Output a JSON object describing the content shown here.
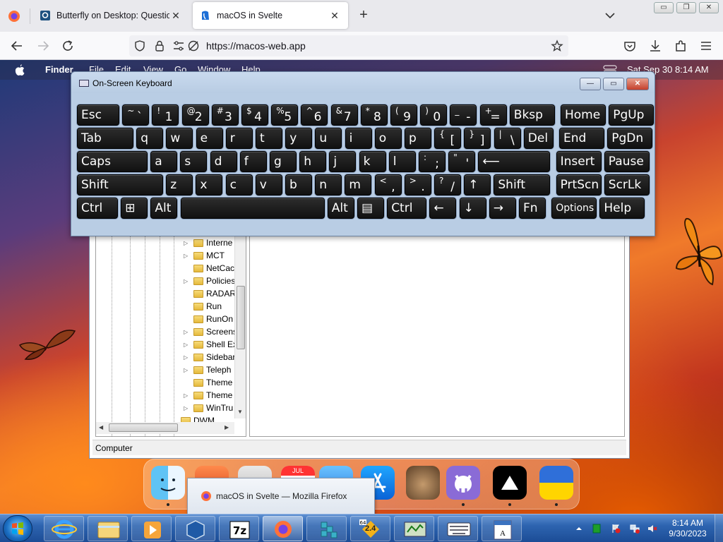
{
  "browser": {
    "tabs": [
      {
        "title": "Butterfly on Desktop: Questions",
        "active": false
      },
      {
        "title": "macOS in Svelte",
        "active": true
      }
    ],
    "url": "https://macos-web.app",
    "window_controls": {
      "minimize": "▭",
      "restore": "❐",
      "close": "✕"
    }
  },
  "menubar": {
    "app": "Finder",
    "items": [
      "File",
      "Edit",
      "View",
      "Go",
      "Window",
      "Help"
    ],
    "clock": "Sat Sep 30   8:14 AM"
  },
  "osk": {
    "title": "On-Screen Keyboard",
    "controls": {
      "minimize": "—",
      "restore": "▭",
      "close": "✕"
    },
    "rows": [
      [
        {
          "label": "Esc"
        },
        {
          "shift": "~",
          "main": "`"
        },
        {
          "shift": "!",
          "main": "1"
        },
        {
          "shift": "@",
          "main": "2"
        },
        {
          "shift": "#",
          "main": "3"
        },
        {
          "shift": "$",
          "main": "4"
        },
        {
          "shift": "%",
          "main": "5"
        },
        {
          "shift": "^",
          "main": "6"
        },
        {
          "shift": "&",
          "main": "7"
        },
        {
          "shift": "*",
          "main": "8"
        },
        {
          "shift": "(",
          "main": "9"
        },
        {
          "shift": ")",
          "main": "0"
        },
        {
          "shift": "_",
          "main": "-"
        },
        {
          "shift": "+",
          "main": "="
        },
        {
          "label": "Bksp"
        },
        {
          "label": "Home"
        },
        {
          "label": "PgUp"
        }
      ],
      [
        {
          "label": "Tab"
        },
        {
          "label": "q"
        },
        {
          "label": "w"
        },
        {
          "label": "e"
        },
        {
          "label": "r"
        },
        {
          "label": "t"
        },
        {
          "label": "y"
        },
        {
          "label": "u"
        },
        {
          "label": "i"
        },
        {
          "label": "o"
        },
        {
          "label": "p"
        },
        {
          "shift": "{",
          "main": "["
        },
        {
          "shift": "}",
          "main": "]"
        },
        {
          "shift": "|",
          "main": "\\"
        },
        {
          "label": "Del"
        },
        {
          "label": "End"
        },
        {
          "label": "PgDn"
        }
      ],
      [
        {
          "label": "Caps"
        },
        {
          "label": "a"
        },
        {
          "label": "s"
        },
        {
          "label": "d"
        },
        {
          "label": "f"
        },
        {
          "label": "g"
        },
        {
          "label": "h"
        },
        {
          "label": "j"
        },
        {
          "label": "k"
        },
        {
          "label": "l"
        },
        {
          "shift": ":",
          "main": ";"
        },
        {
          "shift": "\"",
          "main": "'"
        },
        {
          "label": "⟵"
        },
        {
          "label": "Insert"
        },
        {
          "label": "Pause"
        }
      ],
      [
        {
          "label": "Shift"
        },
        {
          "label": "z"
        },
        {
          "label": "x"
        },
        {
          "label": "c"
        },
        {
          "label": "v"
        },
        {
          "label": "b"
        },
        {
          "label": "n"
        },
        {
          "label": "m"
        },
        {
          "shift": "<",
          "main": ","
        },
        {
          "shift": ">",
          "main": "."
        },
        {
          "shift": "?",
          "main": "/"
        },
        {
          "label": "↑"
        },
        {
          "label": "Shift"
        },
        {
          "label": "PrtScn"
        },
        {
          "label": "ScrLk"
        }
      ],
      [
        {
          "label": "Ctrl"
        },
        {
          "label": "⊞"
        },
        {
          "label": "Alt"
        },
        {
          "label": ""
        },
        {
          "label": "Alt"
        },
        {
          "label": "▤"
        },
        {
          "label": "Ctrl"
        },
        {
          "label": "←"
        },
        {
          "label": "↓"
        },
        {
          "label": "→"
        },
        {
          "label": "Fn"
        },
        {
          "label": "Options"
        },
        {
          "label": "Help"
        }
      ]
    ]
  },
  "regedit": {
    "tree_items": [
      "Interne",
      "MCT",
      "NetCac",
      "Policies",
      "RADAR",
      "Run",
      "RunOn",
      "Screens",
      "Shell Ex",
      "Sidebar",
      "Teleph",
      "Theme",
      "Theme",
      "WinTru",
      "DWM"
    ],
    "status": "Computer"
  },
  "dock": {
    "tooltip": "macOS in Svelte — Mozilla Firefox"
  },
  "taskbar": {
    "time": "8:14 AM",
    "date": "9/30/2023",
    "app_badge": "2.4"
  }
}
